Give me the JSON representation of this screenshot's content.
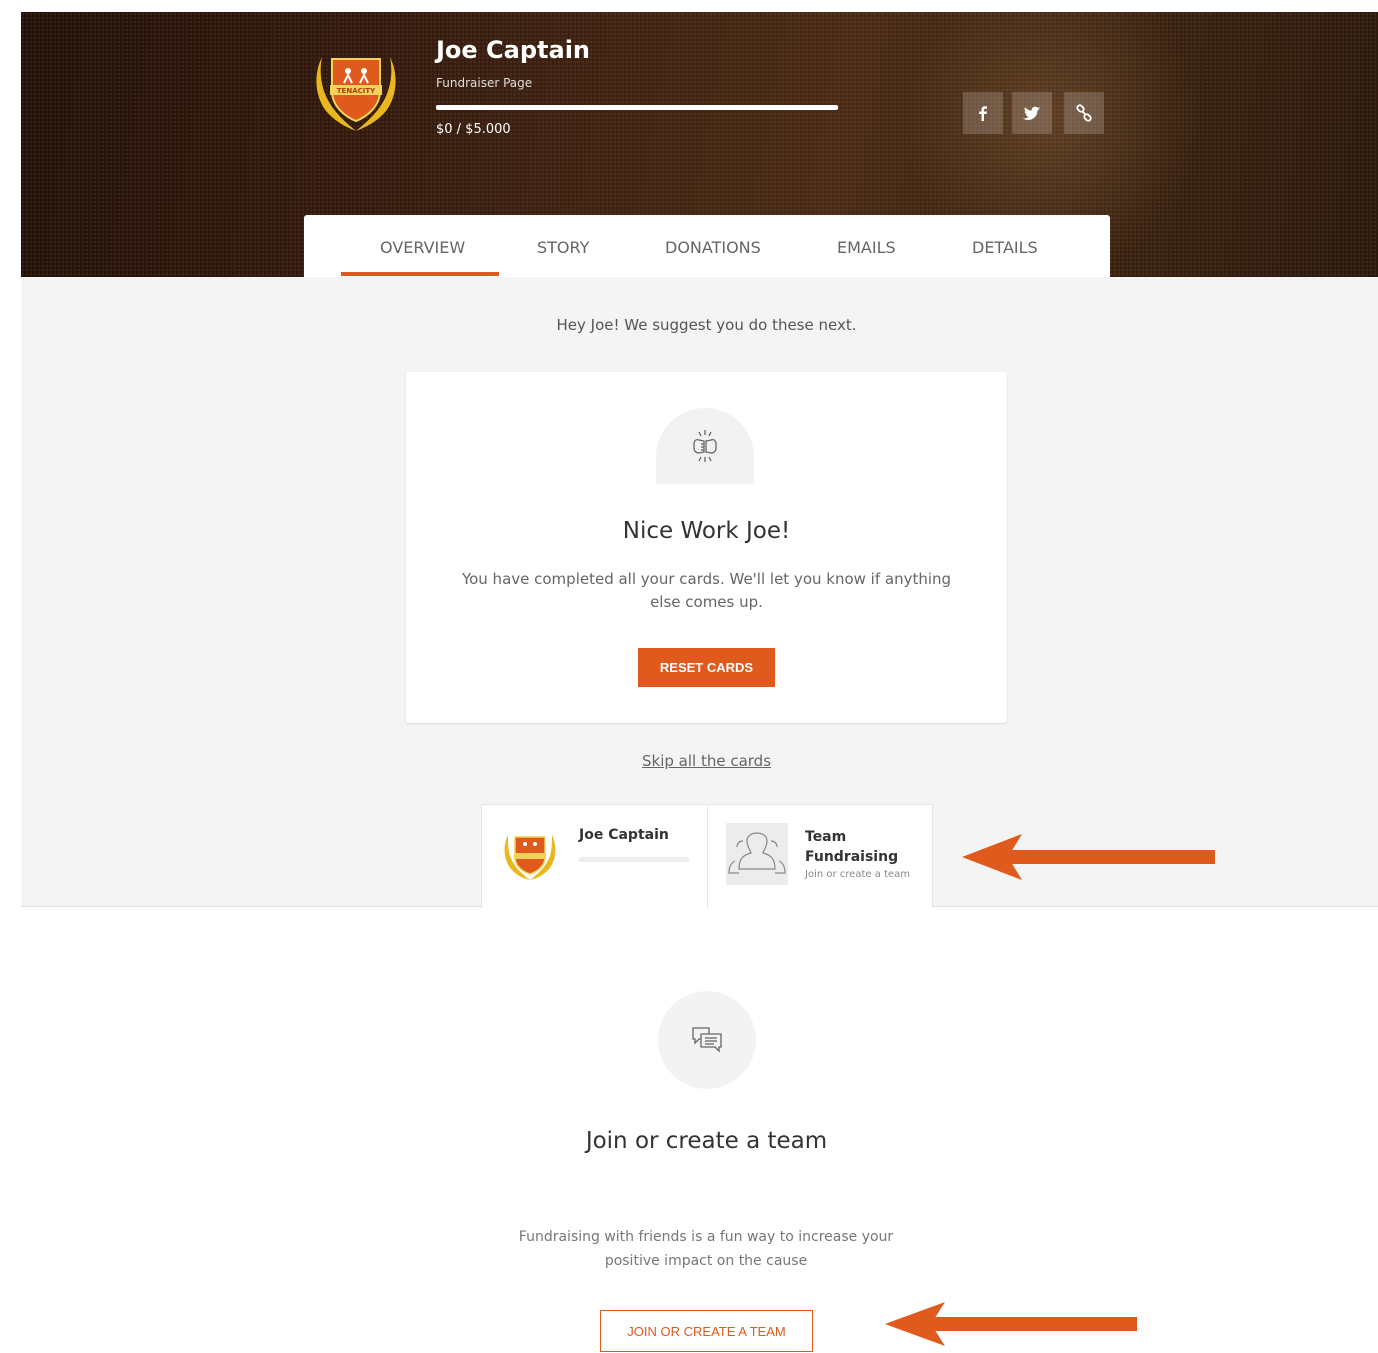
{
  "header": {
    "name": "Joe Captain",
    "subtitle": "Fundraiser Page",
    "amount": "$0 / $5.000",
    "progress_percent": 0,
    "logo_text": "TENACITY",
    "social": [
      {
        "icon": "facebook-icon",
        "glyph": "f"
      },
      {
        "icon": "twitter-icon"
      },
      {
        "icon": "link-icon"
      }
    ]
  },
  "tabs": [
    "OVERVIEW",
    "STORY",
    "DONATIONS",
    "EMAILS",
    "DETAILS"
  ],
  "active_tab": "OVERVIEW",
  "suggest_text": "Hey Joe! We suggest you do these next.",
  "card": {
    "title": "Nice Work Joe!",
    "text": "You have completed all your cards. We'll let you know if anything else comes up.",
    "button": "RESET CARDS"
  },
  "skip_link": "Skip all the cards",
  "mini_cards": {
    "profile_name": "Joe Captain",
    "team_title": "Team Fundraising",
    "team_sub": "Join or create a team"
  },
  "team_section": {
    "heading": "Join or create a team",
    "text": "Fundraising with friends is a fun way to increase your positive impact on the cause",
    "button": "JOIN OR CREATE A TEAM"
  },
  "colors": {
    "accent": "#e05a1e",
    "arrow": "#e05a1e"
  }
}
